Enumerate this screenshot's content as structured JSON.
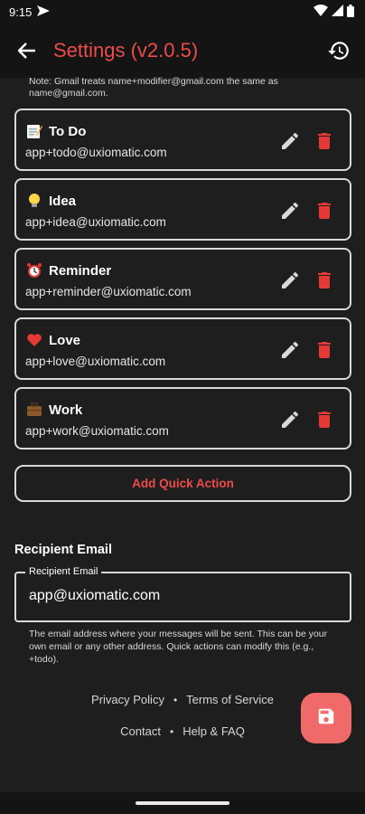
{
  "status_bar": {
    "time": "9:15"
  },
  "app_bar": {
    "title": "Settings (v2.0.5)"
  },
  "note": "Note: Gmail treats name+modifier@gmail.com the same as name@gmail.com.",
  "quick_actions": [
    {
      "emoji": "memo-icon",
      "title": "To Do",
      "email": "app+todo@uxiomatic.com"
    },
    {
      "emoji": "light-bulb-icon",
      "title": "Idea",
      "email": "app+idea@uxiomatic.com"
    },
    {
      "emoji": "alarm-clock-icon",
      "title": "Reminder",
      "email": "app+reminder@uxiomatic.com"
    },
    {
      "emoji": "heart-icon",
      "title": "Love",
      "email": "app+love@uxiomatic.com"
    },
    {
      "emoji": "briefcase-icon",
      "title": "Work",
      "email": "app+work@uxiomatic.com"
    }
  ],
  "add_quick_action_label": "Add Quick Action",
  "recipient": {
    "section_title": "Recipient Email",
    "field_label": "Recipient Email",
    "value": "app@uxiomatic.com",
    "helper": "The email address where your messages will be sent. This can be your own email or any other address. Quick actions can modify this (e.g., +todo)."
  },
  "links": {
    "privacy": "Privacy Policy",
    "terms": "Terms of Service",
    "contact": "Contact",
    "help": "Help & FAQ",
    "separator": "•"
  },
  "colors": {
    "accent": "#ee4b4b",
    "delete": "#e53935",
    "fab": "#f06a6a",
    "background": "#1e1e1e"
  }
}
